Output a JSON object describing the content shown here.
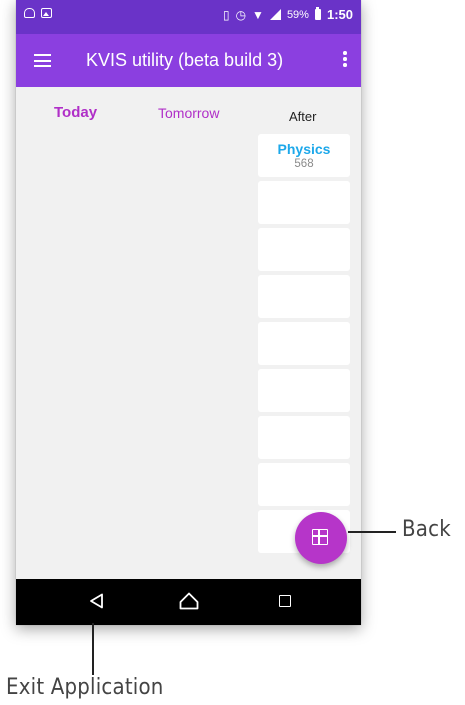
{
  "status_bar": {
    "battery_percent": "59%",
    "time": "1:50",
    "icons": [
      "photo-notification-icon",
      "image-notification-icon",
      "vibrate-icon",
      "alarm-icon",
      "wifi-icon",
      "signal-icon",
      "battery-icon"
    ]
  },
  "app_bar": {
    "title": "KVIS utility (beta build 3)",
    "menu_icon": "hamburger-menu-icon",
    "overflow_icon": "overflow-menu-icon"
  },
  "tabs": [
    {
      "label": "Today",
      "color": "#b02fc8"
    },
    {
      "label": "Tomorrow",
      "color": "#b02fc8"
    },
    {
      "label": "After",
      "color": "#222222"
    }
  ],
  "after_column": {
    "first_item": {
      "subject": "Physics",
      "room": "568",
      "subject_color": "#1da8ea"
    },
    "empty_slots": 8
  },
  "fab": {
    "icon": "grid-icon",
    "color": "#b635c9"
  },
  "nav_bar": {
    "icons": [
      "back-icon",
      "home-icon",
      "recent-apps-icon"
    ]
  },
  "annotations": {
    "back": "Back",
    "exit": "Exit Application"
  },
  "colors": {
    "status_bar": "#6a33c8",
    "app_bar": "#8b3fe0",
    "content_bg": "#f1f1f1"
  }
}
